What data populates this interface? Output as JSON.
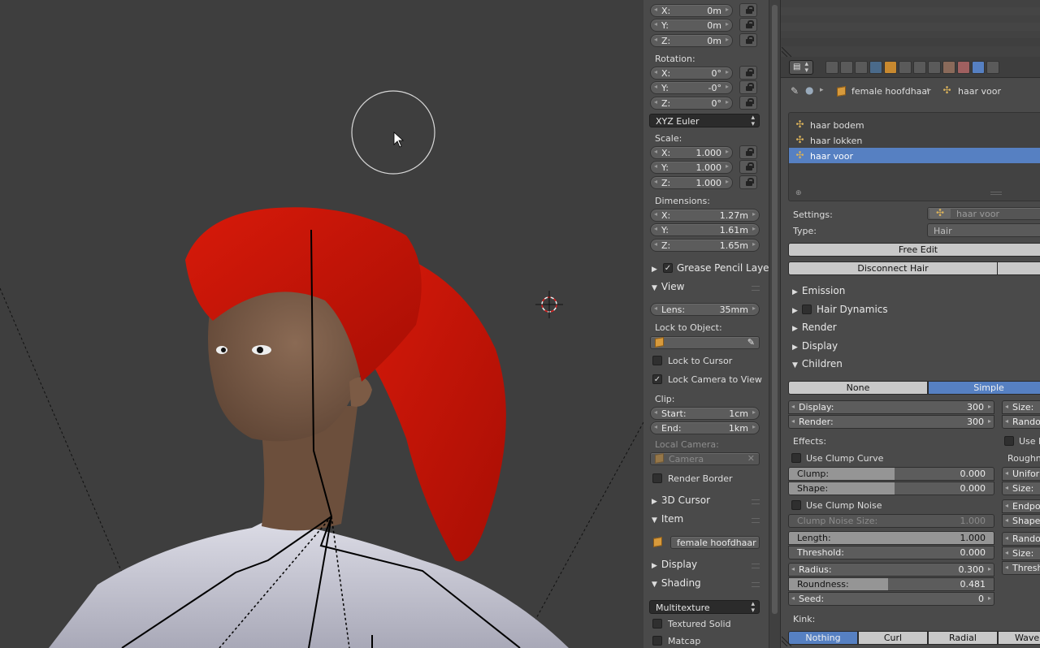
{
  "npanel": {
    "location": {
      "x": {
        "label": "X:",
        "value": "0m"
      },
      "y": {
        "label": "Y:",
        "value": "0m"
      },
      "z": {
        "label": "Z:",
        "value": "0m"
      }
    },
    "rotation_label": "Rotation:",
    "rotation": {
      "x": {
        "label": "X:",
        "value": "0°"
      },
      "y": {
        "label": "Y:",
        "value": "-0°"
      },
      "z": {
        "label": "Z:",
        "value": "0°"
      }
    },
    "rotation_mode": "XYZ Euler",
    "scale_label": "Scale:",
    "scale": {
      "x": {
        "label": "X:",
        "value": "1.000"
      },
      "y": {
        "label": "Y:",
        "value": "1.000"
      },
      "z": {
        "label": "Z:",
        "value": "1.000"
      }
    },
    "dimensions_label": "Dimensions:",
    "dimensions": {
      "x": {
        "label": "X:",
        "value": "1.27m"
      },
      "y": {
        "label": "Y:",
        "value": "1.61m"
      },
      "z": {
        "label": "Z:",
        "value": "1.65m"
      }
    },
    "grease_pencil": "Grease Pencil Layers",
    "view": {
      "header": "View",
      "lens_label": "Lens:",
      "lens_value": "35mm",
      "lock_to_object": "Lock to Object:",
      "lock_to_cursor": "Lock to Cursor",
      "lock_camera_to_view": "Lock Camera to View",
      "clip_label": "Clip:",
      "clip_start_label": "Start:",
      "clip_start_value": "1cm",
      "clip_end_label": "End:",
      "clip_end_value": "1km",
      "local_camera_label": "Local Camera:",
      "local_camera_value": "Camera",
      "render_border": "Render Border"
    },
    "cursor_header": "3D Cursor",
    "item": {
      "header": "Item",
      "name": "female hoofdhaar"
    },
    "display_header": "Display",
    "shading": {
      "header": "Shading",
      "mode": "Multitexture",
      "textured_solid": "Textured Solid",
      "matcap": "Matcap"
    }
  },
  "props": {
    "breadcrumb": {
      "object": "female hoofdhaar",
      "psys": "haar voor"
    },
    "particle_list": [
      {
        "name": "haar bodem",
        "selected": false
      },
      {
        "name": "haar lokken",
        "selected": false
      },
      {
        "name": "haar voor",
        "selected": true
      }
    ],
    "settings_label": "Settings:",
    "settings_value": "haar voor",
    "type_label": "Type:",
    "type_value": "Hair",
    "free_edit": "Free Edit",
    "disconnect_hair": "Disconnect Hair",
    "panels": {
      "emission": "Emission",
      "hair_dynamics": "Hair Dynamics",
      "render": "Render",
      "display": "Display",
      "children": "Children"
    },
    "children": {
      "none": "None",
      "simple": "Simple",
      "display_label": "Display:",
      "display_value": "300",
      "render_label": "Render:",
      "render_value": "300",
      "effects_label": "Effects:",
      "use_clump_curve": "Use Clump Curve",
      "clump_label": "Clump:",
      "clump_value": "0.000",
      "shape_label": "Shape:",
      "shape_value": "0.000",
      "use_clump_noise": "Use Clump Noise",
      "clump_noise_size_label": "Clump Noise Size:",
      "clump_noise_size_value": "1.000",
      "length_label": "Length:",
      "length_value": "1.000",
      "threshold_label": "Threshold:",
      "threshold_value": "0.000",
      "radius_label": "Radius:",
      "radius_value": "0.300",
      "roundness_label": "Roundness:",
      "roundness_value": "0.481",
      "roundness_fraction": 0.481,
      "seed_label": "Seed:",
      "seed_value": "0",
      "kink_label": "Kink:",
      "kink_options": [
        "Nothing",
        "Curl",
        "Radial",
        "Wave"
      ],
      "right_col": {
        "size1": "Size:",
        "random1": "Randor",
        "use_r": "Use R",
        "roughness": "Roughne",
        "uniform": "Uniforr",
        "size2": "Size:",
        "endpoint": "Endpoir",
        "shape": "Shape:",
        "random2": "Randor",
        "size3": "Size:",
        "thresh": "Thresh"
      }
    }
  },
  "colors": {
    "accent": "#5680c2",
    "hair": "#c41408",
    "skin": "#7a5a44",
    "shirt": "#d8d8e2"
  }
}
